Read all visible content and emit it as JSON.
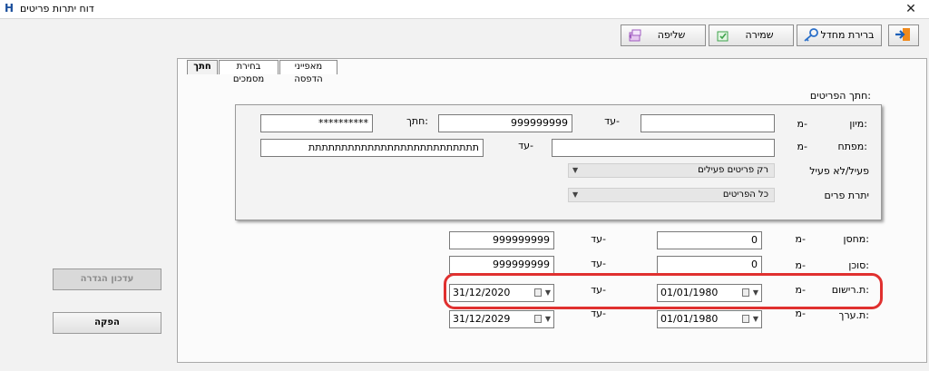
{
  "window": {
    "title": "דוח יתרות פריטים",
    "app_icon": "H",
    "close": "✕"
  },
  "toolbar": {
    "exit_icon": "exit-door-icon",
    "filter_label": "ברירת מחדל",
    "save_label": "שמירה",
    "load_label": "שליפה"
  },
  "tabs": [
    "חתך",
    "בחירת מסמכים",
    "מאפייני הדפסה"
  ],
  "section_title": "חתך הפריטים:",
  "group": {
    "sort_label": "מיון:",
    "from1": "מ-",
    "sort_to_label": "עד-",
    "sort_to_value": "999999999",
    "cut_label": "חתך:",
    "cut_value": "**********",
    "key_label": "מפתח:",
    "from2": "מ-",
    "key_to_label": "עד-",
    "key_to_value": "תתתתתתתתתתתתתתתתתתתתתתתתתת",
    "active_label": "פעיל/לא פעיל",
    "active_value": "רק פריטים פעילים",
    "balance_label": "יתרת פרים",
    "balance_value": "כל הפריטים"
  },
  "rows": {
    "warehouse_label": "מחסן:",
    "warehouse_from_label": "מ-",
    "warehouse_from": "0",
    "warehouse_to_label": "עד-",
    "warehouse_to": "999999999",
    "agent_label": "סוכן:",
    "agent_from_label": "מ-",
    "agent_from": "0",
    "agent_to_label": "עד-",
    "agent_to": "999999999",
    "reg_label": "ת.רישום:",
    "reg_from_label": "מ-",
    "reg_from": "01/01/1980",
    "reg_to_label": "עד-",
    "reg_to": "31/12/2020",
    "val_label": "ת.ערך:",
    "val_from_label": "מ-",
    "val_from": "01/01/1980",
    "val_to_label": "עד-",
    "val_to": "31/12/2029"
  },
  "side": {
    "update_label": "עדכון הגדרה",
    "run_label": "הפקה"
  },
  "colors": {
    "highlight": "#e0302f",
    "panel_bg": "#fbfbfb"
  }
}
